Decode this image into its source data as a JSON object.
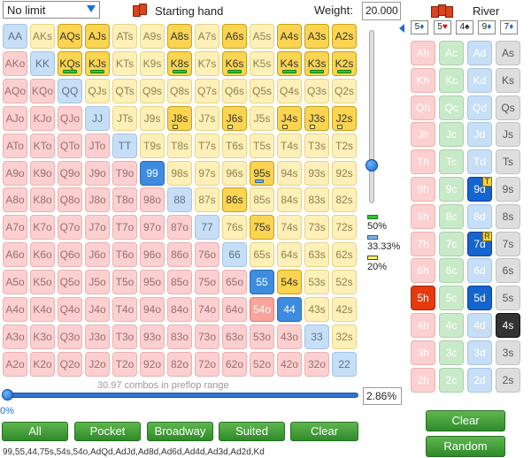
{
  "toolbar": {
    "limit_value": "No limit",
    "starting_hand_label": "Starting hand",
    "weight_label": "Weight:",
    "weight_value": "20.000"
  },
  "grid": {
    "rows": [
      [
        "AA",
        "AKs",
        "AQs",
        "AJs",
        "ATs",
        "A9s",
        "A8s",
        "A7s",
        "A6s",
        "A5s",
        "A4s",
        "A3s",
        "A2s"
      ],
      [
        "AKo",
        "KK",
        "KQs",
        "KJs",
        "KTs",
        "K9s",
        "K8s",
        "K7s",
        "K6s",
        "K5s",
        "K4s",
        "K3s",
        "K2s"
      ],
      [
        "AQo",
        "KQo",
        "QQ",
        "QJs",
        "QTs",
        "Q9s",
        "Q8s",
        "Q7s",
        "Q6s",
        "Q5s",
        "Q4s",
        "Q3s",
        "Q2s"
      ],
      [
        "AJo",
        "KJo",
        "QJo",
        "JJ",
        "JTs",
        "J9s",
        "J8s",
        "J7s",
        "J6s",
        "J5s",
        "J4s",
        "J3s",
        "J2s"
      ],
      [
        "ATo",
        "KTo",
        "QTo",
        "JTo",
        "TT",
        "T9s",
        "T8s",
        "T7s",
        "T6s",
        "T5s",
        "T4s",
        "T3s",
        "T2s"
      ],
      [
        "A9o",
        "K9o",
        "Q9o",
        "J9o",
        "T9o",
        "99",
        "98s",
        "97s",
        "96s",
        "95s",
        "94s",
        "93s",
        "92s"
      ],
      [
        "A8o",
        "K8o",
        "Q8o",
        "J8o",
        "T8o",
        "98o",
        "88",
        "87s",
        "86s",
        "85s",
        "84s",
        "83s",
        "82s"
      ],
      [
        "A7o",
        "K7o",
        "Q7o",
        "J7o",
        "T7o",
        "97o",
        "87o",
        "77",
        "76s",
        "75s",
        "74s",
        "73s",
        "72s"
      ],
      [
        "A6o",
        "K6o",
        "Q6o",
        "J6o",
        "T6o",
        "96o",
        "86o",
        "76o",
        "66",
        "65s",
        "64s",
        "63s",
        "62s"
      ],
      [
        "A5o",
        "K5o",
        "Q5o",
        "J5o",
        "T5o",
        "95o",
        "85o",
        "75o",
        "65o",
        "55",
        "54s",
        "53s",
        "52s"
      ],
      [
        "A4o",
        "K4o",
        "Q4o",
        "J4o",
        "T4o",
        "94o",
        "84o",
        "74o",
        "64o",
        "54o",
        "44",
        "43s",
        "42s"
      ],
      [
        "A3o",
        "K3o",
        "Q3o",
        "J3o",
        "T3o",
        "93o",
        "83o",
        "73o",
        "63o",
        "53o",
        "43o",
        "33",
        "32s"
      ],
      [
        "A2o",
        "K2o",
        "Q2o",
        "J2o",
        "T2o",
        "92o",
        "82o",
        "72o",
        "62o",
        "52o",
        "42o",
        "32o",
        "22"
      ]
    ],
    "selected_yellow": [
      "AQs",
      "AJs",
      "A8s",
      "A6s",
      "A4s",
      "A3s",
      "A2s",
      "KQs",
      "KJs",
      "K8s",
      "K6s",
      "K4s",
      "K3s",
      "K2s",
      "J8s",
      "J6s",
      "J4s",
      "J3s",
      "J2s",
      "95s",
      "86s",
      "75s",
      "54s"
    ],
    "selected_blue": [
      "99",
      "55",
      "44"
    ],
    "selected_red": [
      "54o"
    ],
    "green_bars": [
      "KQs",
      "KJs",
      "K8s",
      "K6s",
      "K4s",
      "K3s",
      "K2s"
    ],
    "blue_bars": [
      "95s"
    ],
    "yellow_bars": [
      "J8s",
      "J6s",
      "J4s",
      "J3s",
      "J2s"
    ]
  },
  "legend": {
    "green_pct": "50%",
    "blue_pct": "33.33%",
    "yellow_pct": "20%",
    "colors": {
      "green": "#2fc82f",
      "blue": "#7ab1e8",
      "yellow": "#fff16a"
    }
  },
  "range": {
    "combos_text": "30.97 combos in preflop range",
    "left_pct": "0%",
    "right_pct": "2.86%",
    "slider_fraction": 0.0,
    "weight_slider_fraction": 0.78,
    "text": "99,55,44,75s,54s,54o,AdQd,AdJd,Ad8d,Ad6d,Ad4d,Ad3d,Ad2d,Kd"
  },
  "buttons": {
    "all": "All",
    "pocket": "Pocket",
    "broadway": "Broadway",
    "suited": "Suited",
    "clear": "Clear"
  },
  "board": {
    "street_label": "River",
    "cards": [
      {
        "rank": "5",
        "suit": "♦",
        "color": "blue"
      },
      {
        "rank": "5",
        "suit": "♥",
        "color": "red"
      },
      {
        "rank": "4",
        "suit": "♠",
        "color": "dark"
      },
      {
        "rank": "9",
        "suit": "♦",
        "color": "blue"
      },
      {
        "rank": "7",
        "suit": "♦",
        "color": "blue"
      }
    ],
    "deck_rows": [
      [
        "Ah",
        "Ac",
        "Ad",
        "As"
      ],
      [
        "Kh",
        "Kc",
        "Kd",
        "Ks"
      ],
      [
        "Qh",
        "Qc",
        "Qd",
        "Qs"
      ],
      [
        "Jh",
        "Jc",
        "Jd",
        "Js"
      ],
      [
        "Th",
        "Tc",
        "Td",
        "Ts"
      ],
      [
        "9h",
        "9c",
        "9d",
        "9s"
      ],
      [
        "8h",
        "8c",
        "8d",
        "8s"
      ],
      [
        "7h",
        "7c",
        "7d",
        "7s"
      ],
      [
        "6h",
        "6c",
        "6d",
        "6s"
      ],
      [
        "5h",
        "5c",
        "5d",
        "5s"
      ],
      [
        "4h",
        "4c",
        "4d",
        "4s"
      ],
      [
        "3h",
        "3c",
        "3d",
        "3s"
      ],
      [
        "2h",
        "2c",
        "2d",
        "2s"
      ]
    ],
    "selected": [
      "5h",
      "5d",
      "4s",
      "9d",
      "7d"
    ],
    "badges": {
      "9d": "T",
      "7d": "R"
    },
    "clear_label": "Clear",
    "random_label": "Random"
  }
}
